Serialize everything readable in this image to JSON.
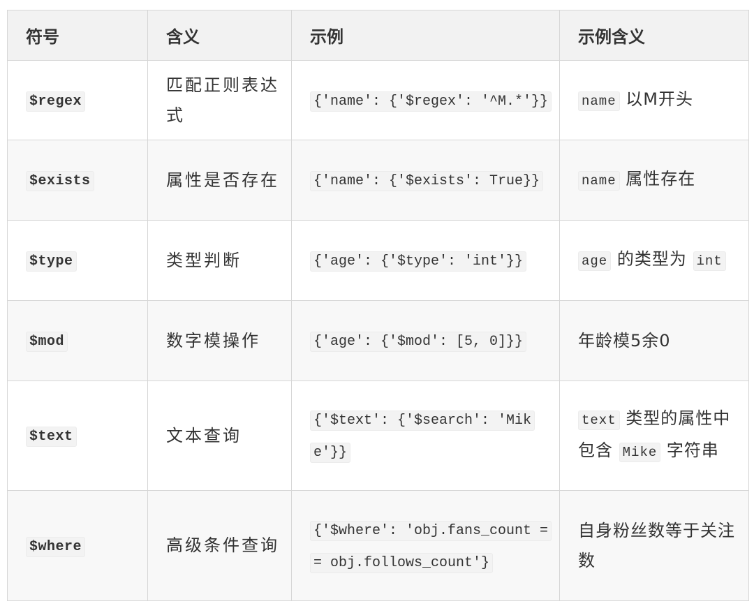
{
  "table": {
    "headers": [
      "符号",
      "含义",
      "示例",
      "示例含义"
    ],
    "rows": [
      {
        "symbol": "$regex",
        "meaning": "匹配正则表达式",
        "example": "{'name': {'$regex': '^M.*'}}",
        "desc_code_1": "name",
        "desc_text_1": "以M开头",
        "desc_code_2": "",
        "desc_text_2": ""
      },
      {
        "symbol": "$exists",
        "meaning": "属性是否存在",
        "example": "{'name': {'$exists': True}}",
        "desc_code_1": "name",
        "desc_text_1": "属性存在",
        "desc_code_2": "",
        "desc_text_2": ""
      },
      {
        "symbol": "$type",
        "meaning": "类型判断",
        "example": "{'age': {'$type': 'int'}}",
        "desc_code_1": "age",
        "desc_text_1": "的类型为",
        "desc_code_2": "int",
        "desc_text_2": ""
      },
      {
        "symbol": "$mod",
        "meaning": "数字模操作",
        "example": "{'age': {'$mod': [5, 0]}}",
        "desc_code_1": "",
        "desc_text_1": "年龄模5余0",
        "desc_code_2": "",
        "desc_text_2": ""
      },
      {
        "symbol": "$text",
        "meaning": "文本查询",
        "example": "{'$text': {'$search': 'Mike'}}",
        "desc_code_1": "text",
        "desc_text_1": "类型的属性中包含",
        "desc_code_2": "Mike",
        "desc_text_2": "字符串"
      },
      {
        "symbol": "$where",
        "meaning": "高级条件查询",
        "example": "{'$where': 'obj.fans_count == obj.follows_count'}",
        "desc_code_1": "",
        "desc_text_1": "自身粉丝数等于关注数",
        "desc_code_2": "",
        "desc_text_2": ""
      }
    ]
  }
}
